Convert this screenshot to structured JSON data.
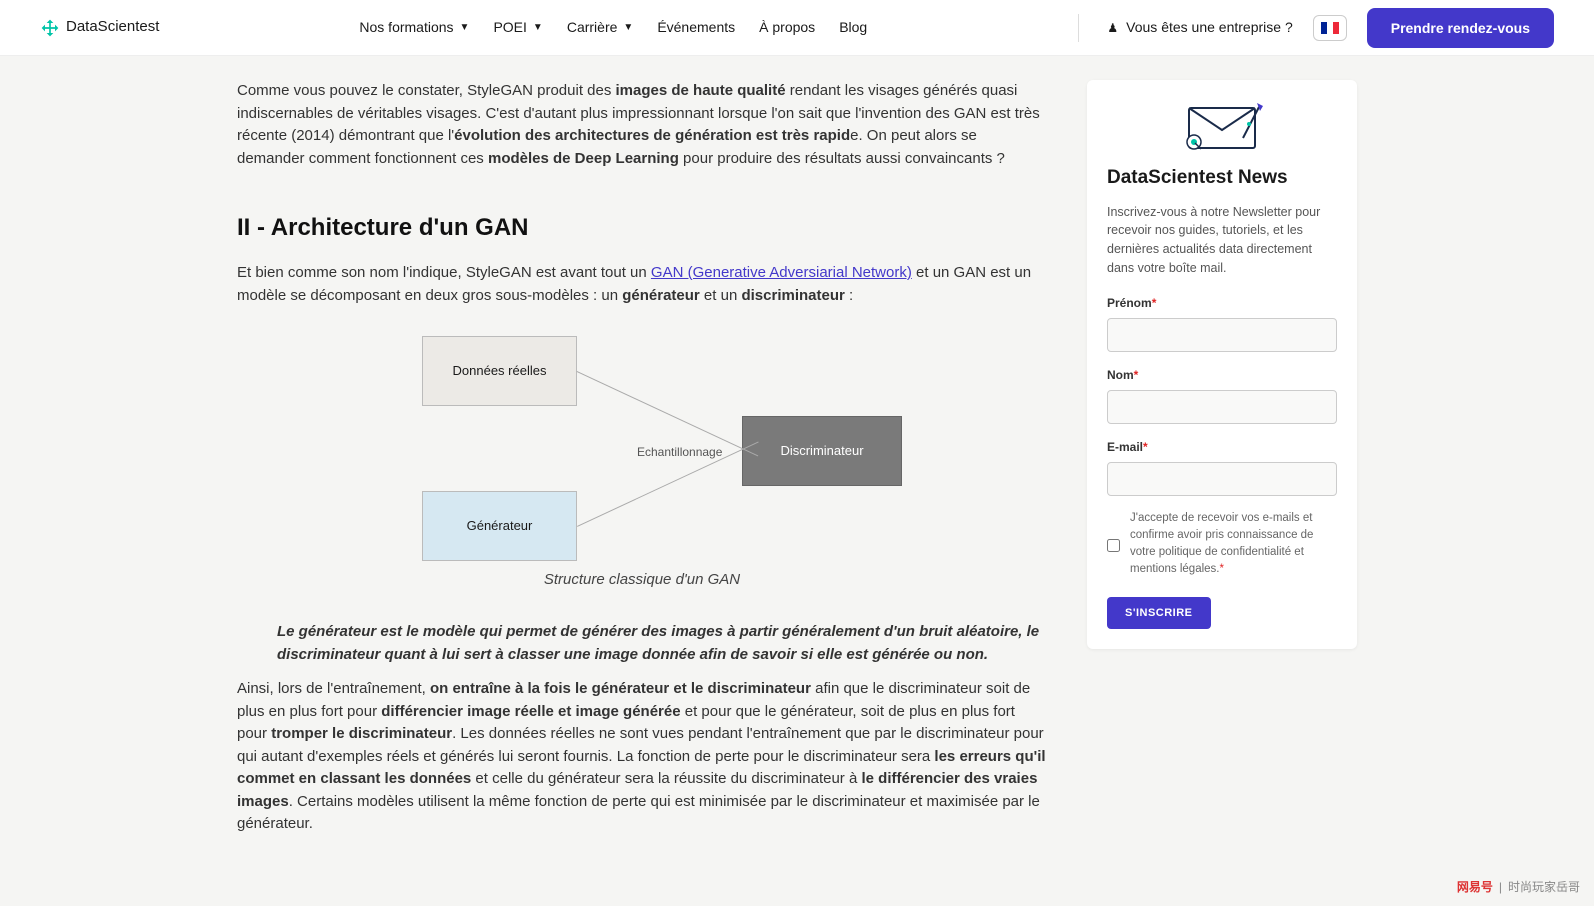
{
  "header": {
    "brand": "DataScientest",
    "nav": {
      "formations": "Nos formations",
      "poei": "POEI",
      "carriere": "Carrière",
      "evenements": "Événements",
      "apropos": "À propos",
      "blog": "Blog"
    },
    "enterprise": "Vous êtes une entreprise ?",
    "cta": "Prendre rendez-vous"
  },
  "article": {
    "p1a": "Comme vous pouvez le constater, StyleGAN produit des ",
    "p1b1": "images de haute qualité",
    "p1c": " rendant les visages générés quasi indiscernables de véritables visages. C'est d'autant plus impressionnant lorsque l'on sait que l'invention des GAN est très récente (2014) démontrant que l'",
    "p1b2": "évolution des architectures de génération est très rapid",
    "p1d": "e. On peut alors se demander comment fonctionnent ces ",
    "p1b3": "modèles de Deep Learning",
    "p1e": " pour produire des résultats aussi convaincants ?",
    "h2": "II - Architecture d'un GAN",
    "p2a": "Et bien comme son nom l'indique, StyleGAN est avant tout un ",
    "p2link": "GAN (Generative Adversiarial Network)",
    "p2b": " et un GAN est un modèle se décomposant en deux gros sous-modèles : un ",
    "p2s1": "générateur",
    "p2c": " et un ",
    "p2s2": "discriminateur",
    "p2d": " :",
    "fig": {
      "data": "Données réelles",
      "gen": "Générateur",
      "disc": "Discriminateur",
      "sample": "Echantillonnage"
    },
    "caption": "Structure classique d'un GAN",
    "emph": "Le générateur est le modèle qui permet de générer des images à partir généralement d'un bruit aléatoire, le discriminateur quant à lui sert à classer une image donnée afin de savoir si elle est générée ou non.",
    "p3a": "Ainsi, lors de l'entraînement, ",
    "p3b1": "on entraîne à la fois le générateur et le discriminateur",
    "p3c": " afin que le discriminateur soit de plus en plus fort pour ",
    "p3b2": "différencier image réelle et image générée",
    "p3d": " et pour que le générateur, soit de plus en plus fort pour ",
    "p3b3": "tromper le discriminateur",
    "p3e": ". Les données réelles ne sont vues pendant l'entraînement que par le discriminateur pour qui autant d'exemples réels et générés lui seront fournis. La fonction de perte pour le discriminateur sera ",
    "p3b4": "les erreurs qu'il commet en classant les données",
    "p3f": " et celle du générateur sera la réussite du discriminateur à ",
    "p3b5": "le différencier des vraies images",
    "p3g": ". Certains modèles utilisent la même fonction de perte qui est minimisée par le discriminateur et maximisée par le générateur."
  },
  "sidebar": {
    "title": "DataScientest News",
    "desc": "Inscrivez-vous à notre Newsletter pour recevoir nos guides, tutoriels, et les dernières actualités data directement dans votre boîte mail.",
    "prenom": "Prénom",
    "nom": "Nom",
    "email": "E-mail",
    "consent": "J'accepte de recevoir vos e-mails et confirme avoir pris connaissance de votre politique de confidentialité et mentions légales.",
    "submit": "S'INSCRIRE"
  },
  "footer": {
    "brand": "网易号",
    "author": "时尚玩家岳哥"
  }
}
